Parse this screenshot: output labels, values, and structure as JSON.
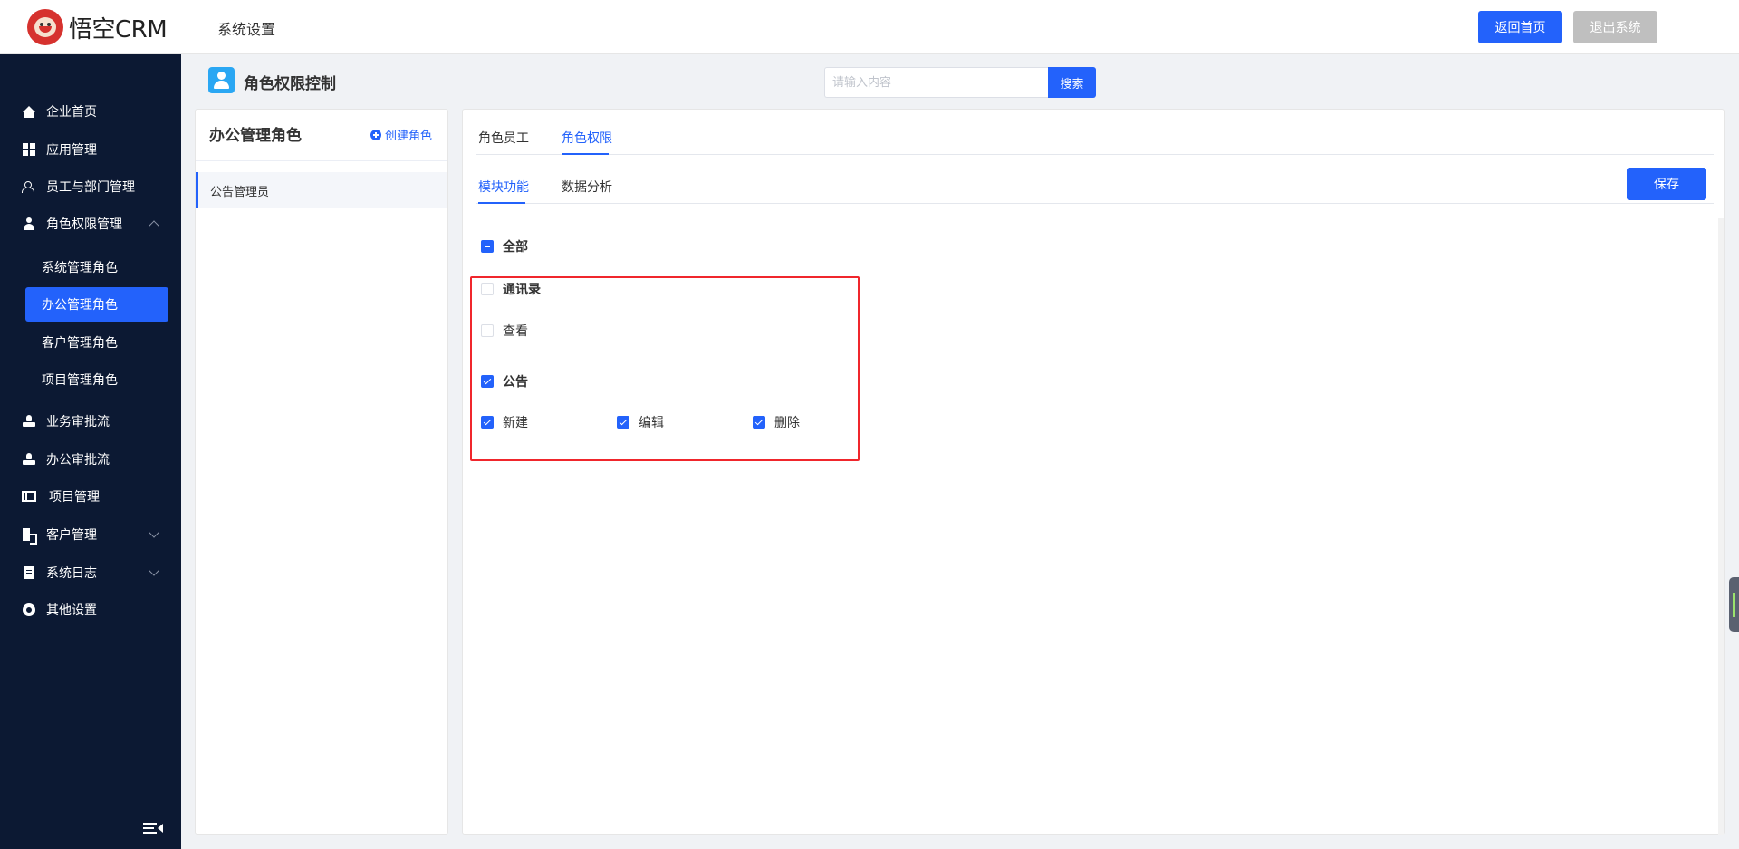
{
  "header": {
    "logo_text": "悟空CRM",
    "title": "系统设置",
    "home_button": "返回首页",
    "logout_button": "退出系统"
  },
  "sidebar": {
    "items": [
      {
        "label": "企业首页",
        "icon": "home-icon"
      },
      {
        "label": "应用管理",
        "icon": "grid-icon"
      },
      {
        "label": "员工与部门管理",
        "icon": "users-icon"
      },
      {
        "label": "角色权限管理",
        "icon": "user-icon",
        "expanded": true
      },
      {
        "label": "业务审批流",
        "icon": "stamp-icon"
      },
      {
        "label": "办公审批流",
        "icon": "stamp-icon"
      },
      {
        "label": "项目管理",
        "icon": "project-icon"
      },
      {
        "label": "客户管理",
        "icon": "building-icon"
      },
      {
        "label": "系统日志",
        "icon": "clipboard-icon"
      },
      {
        "label": "其他设置",
        "icon": "gear-icon"
      }
    ],
    "sub_items": [
      {
        "label": "系统管理角色",
        "active": false
      },
      {
        "label": "办公管理角色",
        "active": true
      },
      {
        "label": "客户管理角色",
        "active": false
      },
      {
        "label": "项目管理角色",
        "active": false
      }
    ]
  },
  "page": {
    "title": "角色权限控制",
    "search_placeholder": "请输入内容",
    "search_button": "搜索"
  },
  "role_panel": {
    "title": "办公管理角色",
    "create_label": "创建角色",
    "roles": [
      "公告管理员"
    ]
  },
  "content": {
    "tabs": [
      "角色员工",
      "角色权限"
    ],
    "active_tab": "角色权限",
    "sub_tabs": [
      "模块功能",
      "数据分析"
    ],
    "active_sub_tab": "模块功能",
    "save_button": "保存",
    "tree": {
      "all_label": "全部",
      "all_state": "indeterminate",
      "groups": [
        {
          "label": "通讯录",
          "checked": false,
          "children": [
            {
              "label": "查看",
              "checked": false
            }
          ]
        },
        {
          "label": "公告",
          "checked": true,
          "children": [
            {
              "label": "新建",
              "checked": true
            },
            {
              "label": "编辑",
              "checked": true
            },
            {
              "label": "删除",
              "checked": true
            }
          ]
        }
      ]
    }
  },
  "colors": {
    "primary": "#2362fb",
    "sidebar_bg": "#0c1933",
    "highlight_border": "#f0262c"
  }
}
